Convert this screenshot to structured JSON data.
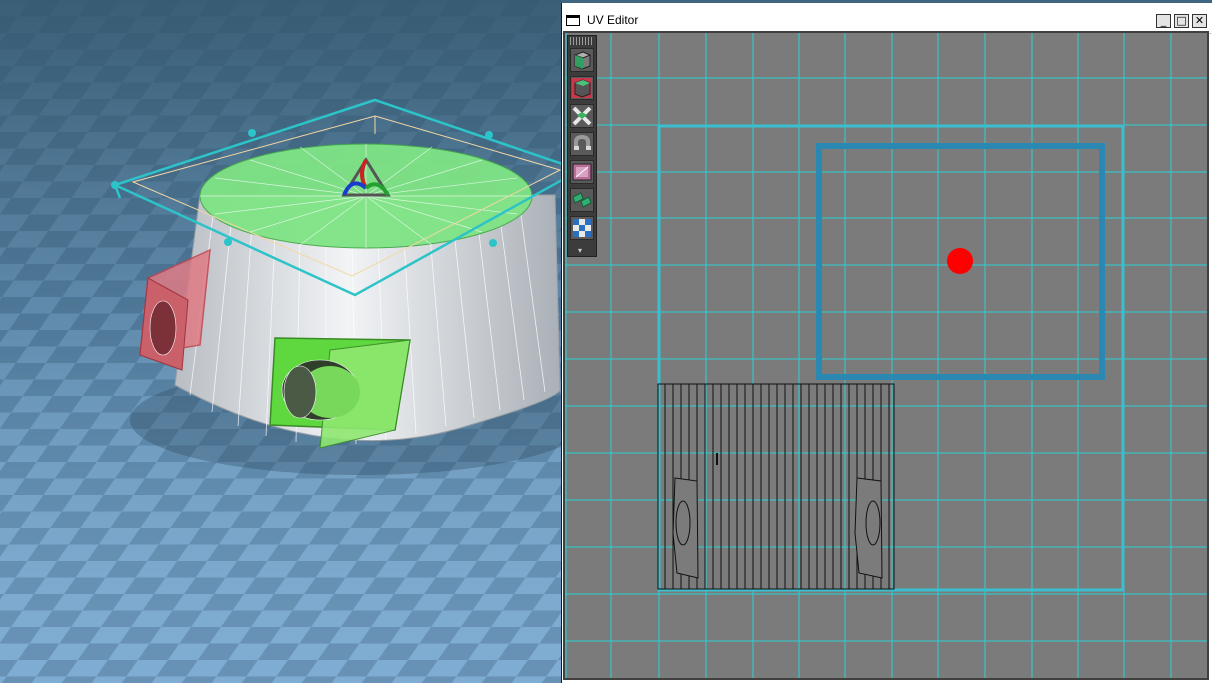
{
  "uv_editor": {
    "title": "UV Editor",
    "minimize": "_",
    "maximize": "□",
    "close": "✕",
    "toolbox": {
      "tools": [
        "cube-select-tool-icon",
        "face-select-tool-icon",
        "vertex-weld-tool-icon",
        "magnet-tool-icon",
        "texture-image-tool-icon",
        "uv-layout-tool-icon",
        "checker-map-tool-icon"
      ],
      "collapse": "▾"
    }
  },
  "colors": {
    "uv_grid": "#2ad0d6",
    "uv_background": "#7b7b7b",
    "texture_bounds": "#38bfd0",
    "selection_box": "#2a88b2",
    "pivot_marker": "#ff0000",
    "viewport_floor": "#6e9cc1",
    "mesh_selected_face": "#77e07a",
    "mesh_body": "#e6e9ec"
  }
}
